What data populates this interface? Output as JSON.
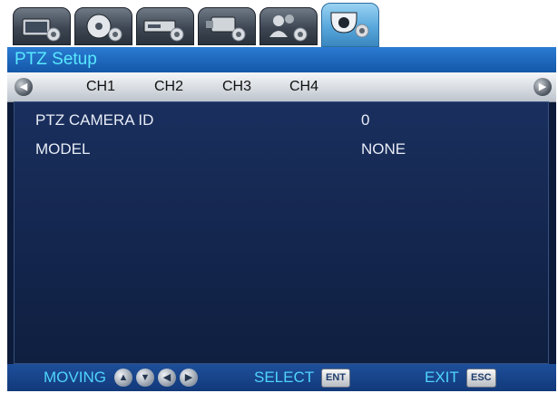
{
  "tabs": [
    {
      "icon": "monitor-settings-icon",
      "active": false
    },
    {
      "icon": "disc-settings-icon",
      "active": false
    },
    {
      "icon": "recorder-settings-icon",
      "active": false
    },
    {
      "icon": "camera-settings-icon",
      "active": false
    },
    {
      "icon": "users-settings-icon",
      "active": false
    },
    {
      "icon": "ptz-settings-icon",
      "active": true
    }
  ],
  "window": {
    "title": "PTZ Setup"
  },
  "channels": {
    "items": [
      "CH1",
      "CH2",
      "CH3",
      "CH4"
    ]
  },
  "settings": {
    "rows": [
      {
        "label": "PTZ CAMERA ID",
        "value": "0"
      },
      {
        "label": "MODEL",
        "value": "NONE"
      }
    ]
  },
  "footer": {
    "moving_label": "MOVING",
    "select_label": "SELECT",
    "select_key": "ENT",
    "exit_label": "EXIT",
    "exit_key": "ESC"
  },
  "colors": {
    "title_text": "#58e8ff",
    "footer_text": "#4fd4ff",
    "accent": "#1457a8"
  }
}
